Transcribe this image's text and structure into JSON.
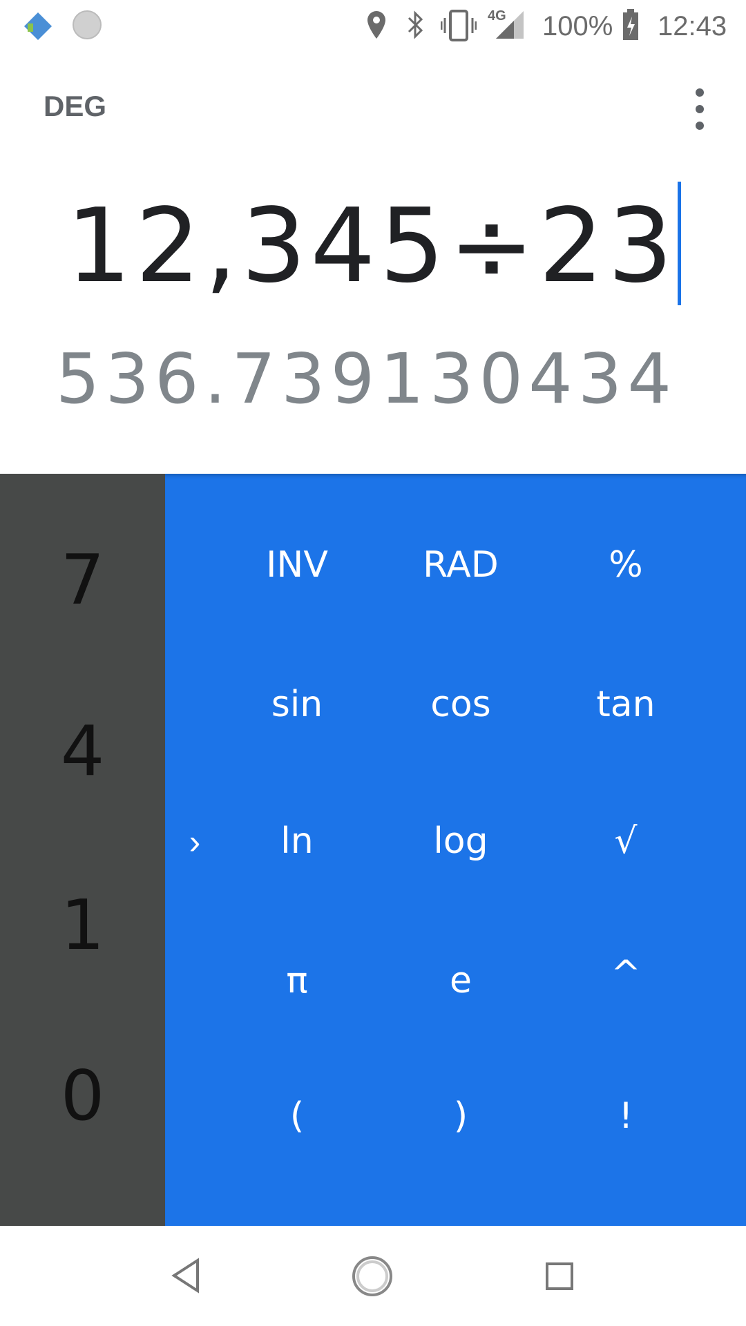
{
  "status_bar": {
    "battery": "100%",
    "time": "12:43",
    "network": "4G"
  },
  "header": {
    "angle_mode": "DEG"
  },
  "display": {
    "formula": "12,345÷23",
    "result": "536.739130434"
  },
  "number_pad": {
    "digits": [
      "7",
      "4",
      "1",
      "0"
    ]
  },
  "advanced_pad": {
    "expand_label": "›",
    "rows": [
      [
        "INV",
        "RAD",
        "%"
      ],
      [
        "sin",
        "cos",
        "tan"
      ],
      [
        "ln",
        "log",
        "√"
      ],
      [
        "π",
        "e",
        "^"
      ],
      [
        "(",
        ")",
        "!"
      ]
    ]
  },
  "colors": {
    "accent": "#1c74e8",
    "numpad": "#474948",
    "cursor": "#1a73e8"
  }
}
